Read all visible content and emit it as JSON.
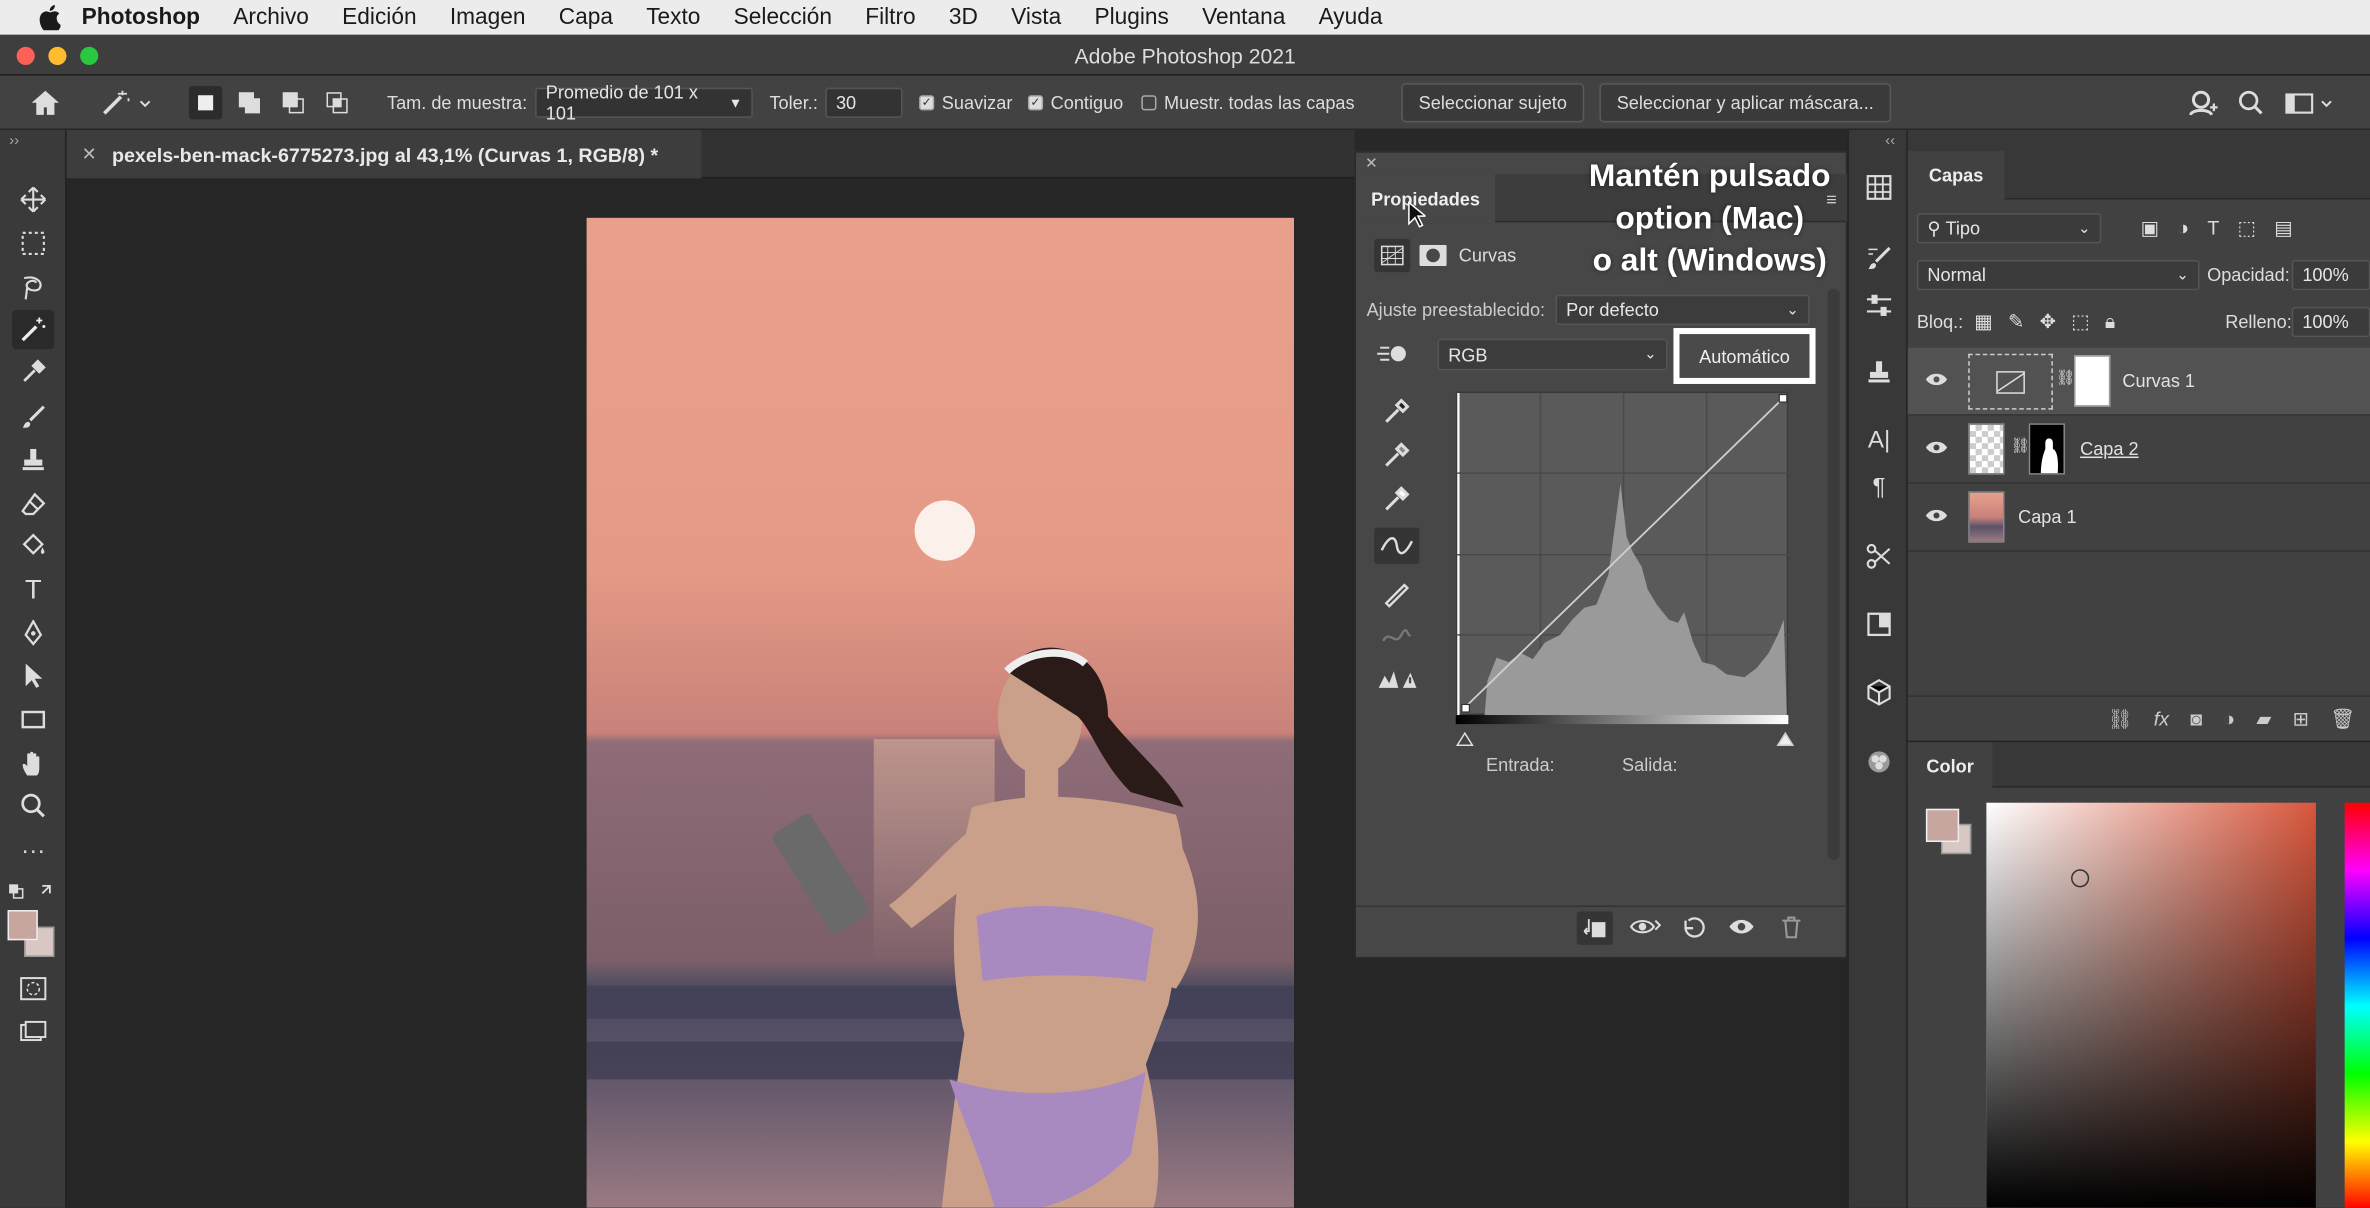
{
  "menubar": {
    "app_name": "Photoshop",
    "items": [
      "Archivo",
      "Edición",
      "Imagen",
      "Capa",
      "Texto",
      "Selección",
      "Filtro",
      "3D",
      "Vista",
      "Plugins",
      "Ventana",
      "Ayuda"
    ]
  },
  "window": {
    "title": "Adobe Photoshop 2021"
  },
  "options": {
    "sample_size_label": "Tam. de muestra:",
    "sample_size_value": "Promedio de 101 x 101",
    "tolerance_label": "Toler.:",
    "tolerance_value": "30",
    "smooth_label": "Suavizar",
    "contiguous_label": "Contiguo",
    "sample_all_label": "Muestr. todas las capas",
    "select_subject_label": "Seleccionar sujeto",
    "select_mask_label": "Seleccionar y aplicar máscara..."
  },
  "document": {
    "tab_title": "pexels-ben-mack-6775273.jpg al 43,1% (Curvas 1, RGB/8) *"
  },
  "properties": {
    "tab_label": "Propiedades",
    "panel_title": "Curvas",
    "preset_label": "Ajuste preestablecido:",
    "preset_value": "Por defecto",
    "channel_value": "RGB",
    "auto_label": "Automático",
    "input_label": "Entrada:",
    "output_label": "Salida:"
  },
  "overlay": {
    "line1": "Mantén pulsado",
    "line2": "option (Mac)",
    "line3": "o alt (Windows)"
  },
  "layers": {
    "tab_label": "Capas",
    "filter_value": "Tipo",
    "blend_mode": "Normal",
    "opacity_label": "Opacidad:",
    "opacity_value": "100%",
    "lock_label": "Bloq.:",
    "fill_label": "Relleno:",
    "fill_value": "100%",
    "items": [
      {
        "name": "Curvas 1"
      },
      {
        "name": "Capa 2"
      },
      {
        "name": "Capa 1"
      }
    ]
  },
  "color_panel": {
    "tab_label": "Color"
  },
  "colors": {
    "accent_highlight": "#ffffff",
    "foreground_swatch": "#c7a6a0",
    "background_swatch": "#d9c7c4"
  }
}
